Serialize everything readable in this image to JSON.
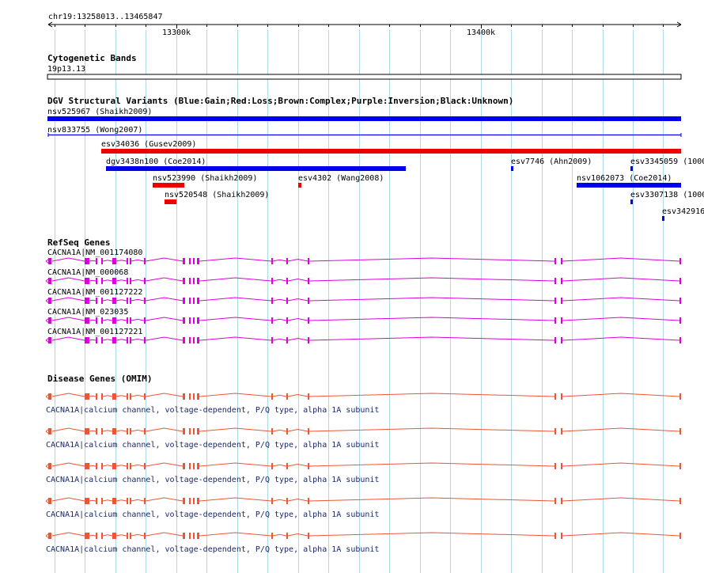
{
  "colors": {
    "grid": "#add8e6",
    "gain": "#0000ee",
    "loss": "#ee0000",
    "refseq": "#dd00dd",
    "omim": "#ee5533",
    "omim_label": "#1a2a6a"
  },
  "ruler": {
    "coordinates": "chr19:13258013..13465847",
    "ticks": [
      {
        "label": "13300k",
        "pos": 13300000
      },
      {
        "label": "13400k",
        "pos": 13400000
      }
    ]
  },
  "range": {
    "start": 13258013,
    "end": 13465847
  },
  "cytoband": {
    "title": "Cytogenetic Bands",
    "band": "19p13.13"
  },
  "dgv": {
    "title": "DGV Structural Variants (Blue:Gain;Red:Loss;Brown:Complex;Purple:Inversion;Black:Unknown)",
    "features": [
      {
        "label": "nsv525967 (Shaikh2009)",
        "type": "gain",
        "style": "bar",
        "row": 0
      },
      {
        "label": "nsv833755 (Wong2007)",
        "type": "gain",
        "style": "line",
        "row": 1
      },
      {
        "label": "esv34036 (Gusev2009)",
        "type": "loss",
        "style": "bar",
        "row": 2
      },
      {
        "label": "dgv3438n100 (Coe2014)",
        "type": "gain",
        "style": "bar",
        "row": 3
      },
      {
        "label": "esv7746 (Ahn2009)",
        "type": "gain",
        "style": "tick",
        "row": 3
      },
      {
        "label": "esv3345059 (1000",
        "type": "gain",
        "style": "tick",
        "row": 3
      },
      {
        "label": "nsv523990 (Shaikh2009)",
        "type": "loss",
        "style": "bar",
        "row": 4
      },
      {
        "label": "esv4302 (Wang2008)",
        "type": "loss",
        "style": "tick",
        "row": 4
      },
      {
        "label": "nsv1062073 (Coe2014)",
        "type": "gain",
        "style": "bar",
        "row": 4
      },
      {
        "label": "nsv520548 (Shaikh2009)",
        "type": "loss",
        "style": "bar",
        "row": 5
      },
      {
        "label": "esv3307138 (1000",
        "type": "gain",
        "style": "tick",
        "row": 5
      },
      {
        "label": "esv342916",
        "type": "gain",
        "style": "tick",
        "row": 6
      }
    ]
  },
  "refseq": {
    "title": "RefSeq Genes",
    "genes": [
      {
        "label": "CACNA1A|NM_001174080"
      },
      {
        "label": "CACNA1A|NM_000068"
      },
      {
        "label": "CACNA1A|NM_001127222"
      },
      {
        "label": "CACNA1A|NM_023035"
      },
      {
        "label": "CACNA1A|NM_001127221"
      }
    ]
  },
  "omim": {
    "title": "Disease Genes (OMIM)",
    "genes": [
      {
        "label": "CACNA1A|calcium channel, voltage-dependent, P/Q type, alpha 1A subunit"
      },
      {
        "label": "CACNA1A|calcium channel, voltage-dependent, P/Q type, alpha 1A subunit"
      },
      {
        "label": "CACNA1A|calcium channel, voltage-dependent, P/Q type, alpha 1A subunit"
      },
      {
        "label": "CACNA1A|calcium channel, voltage-dependent, P/Q type, alpha 1A subunit"
      },
      {
        "label": "CACNA1A|calcium channel, voltage-dependent, P/Q type, alpha 1A subunit"
      }
    ]
  }
}
